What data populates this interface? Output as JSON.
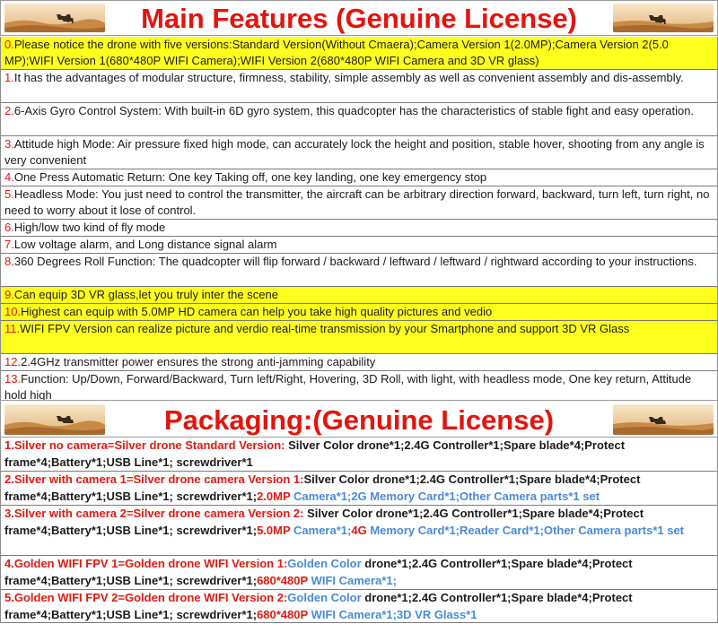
{
  "header_main": {
    "title": "Main Features (Genuine License)"
  },
  "header_packaging": {
    "title": "Packaging:(Genuine License)"
  },
  "features": [
    {
      "num": "0.",
      "text": "Please notice the drone with five versions:Standard Version(Without Cmaera);Camera Version 1(2.0MP);Camera Version 2(5.0 MP);WIFI Version 1(680*480P WIFI Camera);WIFI Version 2(680*480P WIFI Camera and 3D VR glass)",
      "highlight": true
    },
    {
      "num": "1.",
      "text": "It has the advantages of modular structure, firmness, stability, simple assembly as well as convenient assembly and dis-assembly.",
      "highlight": false
    },
    {
      "num": "2.",
      "text": "6-Axis Gyro Control System: With built-in 6D gyro system, this quadcopter has the characteristics of stable fight and easy operation.",
      "highlight": false
    },
    {
      "num": "3.",
      "text": "Attitude high Mode: Air pressure fixed high mode, can accurately lock the height and position, stable hover, shooting from any angle is very convenient",
      "highlight": false
    },
    {
      "num": "4.",
      "text": "One Press Automatic Return: One key Taking off, one key landing, one key emergency stop",
      "highlight": false
    },
    {
      "num": "5.",
      "text": "Headless Mode: You just need to control the transmitter, the aircraft can be arbitrary direction forward, backward, turn left, turn right, no need to worry about it lose of control.",
      "highlight": false
    },
    {
      "num": "6.",
      "text": "High/low two kind of fly mode",
      "highlight": false
    },
    {
      "num": "7.",
      "text": "Low voltage alarm, and Long distance signal alarm",
      "highlight": false
    },
    {
      "num": "8.",
      "text": "360 Degrees Roll Function: The quadcopter will flip forward / backward / leftward / leftward / rightward according to your instructions.",
      "highlight": false
    },
    {
      "num": "9.",
      "text": "Can equip 3D VR glass,let you truly inter the scene",
      "highlight": true
    },
    {
      "num": "10.",
      "text": "Highest can equip with 5.0MP HD camera can help you take high quality pictures and vedio",
      "highlight": true
    },
    {
      "num": "11.",
      "text": "WIFI FPV Version can realize picture and verdio real-time transmission by your Smartphone and support 3D VR Glass",
      "highlight": true
    },
    {
      "num": "12.",
      "text": "2.4GHz transmitter power ensures the strong anti-jamming capability",
      "highlight": false
    },
    {
      "num": "13.",
      "text": "Function: Up/Down, Forward/Backward, Turn left/Right, Hovering, 3D Roll, with light, with headless mode, One key return, Attitude hold high",
      "highlight": false
    }
  ],
  "packaging": [
    {
      "parts": [
        {
          "t": "1.Silver no camera=Silver drone Standard Version: ",
          "c": "red"
        },
        {
          "t": "Silver Color drone*1;2.4G Controller*1;Spare blade*4;Protect frame*4;Battery*1;USB Line*1; screwdriver*1",
          "c": "blk"
        }
      ]
    },
    {
      "parts": [
        {
          "t": "2.Silver with camera 1=Silver drone camera Version 1:",
          "c": "red"
        },
        {
          "t": "Silver Color drone*1;2.4G Controller*1;Spare blade*4;Protect frame*4;Battery*1;USB Line*1; screwdriver*1;",
          "c": "blk"
        },
        {
          "t": "2.0MP ",
          "c": "red"
        },
        {
          "t": "Camera*1;2G Memory Card*1;Other Camera parts*1 set",
          "c": "blue"
        }
      ]
    },
    {
      "parts": [
        {
          "t": "3.Silver with camera 2=Silver drone camera Version 2: ",
          "c": "red"
        },
        {
          "t": "Silver Color drone*1;2.4G Controller*1;Spare blade*4;Protect frame*4;Battery*1;USB Line*1; screwdriver*1;",
          "c": "blk"
        },
        {
          "t": "5.0MP ",
          "c": "red"
        },
        {
          "t": "Camera*1;",
          "c": "blue"
        },
        {
          "t": "4G ",
          "c": "red"
        },
        {
          "t": "Memory Card*1;Reader Card*1;Other Camera parts*1 set",
          "c": "blue"
        }
      ]
    },
    {
      "parts": [
        {
          "t": "4.Golden WIFI FPV 1=Golden drone WIFI Version 1:",
          "c": "red"
        },
        {
          "t": "Golden Color ",
          "c": "blue"
        },
        {
          "t": "drone*1;2.4G Controller*1;Spare blade*4;Protect frame*4;Battery*1;USB Line*1; screwdriver*1;",
          "c": "blk"
        },
        {
          "t": "680*480P ",
          "c": "red"
        },
        {
          "t": "WIFI Camera*1;",
          "c": "blue"
        }
      ]
    },
    {
      "parts": [
        {
          "t": "5.Golden WIFI FPV 2=Golden drone WIFI Version 2:",
          "c": "red"
        },
        {
          "t": "Golden Color ",
          "c": "blue"
        },
        {
          "t": "drone*1;2.4G Controller*1;Spare blade*4;Protect frame*4;Battery*1;USB Line*1; screwdriver*1;",
          "c": "blk"
        },
        {
          "t": "680*480P ",
          "c": "red"
        },
        {
          "t": "WIFI Camera*1;3D VR Glass*1",
          "c": "blue"
        }
      ]
    }
  ],
  "colors": {
    "title_red": "#e4140d",
    "number_red": "#e01b12",
    "highlight_yellow": "#ffff1e",
    "accent_blue": "#4a8ad8"
  }
}
